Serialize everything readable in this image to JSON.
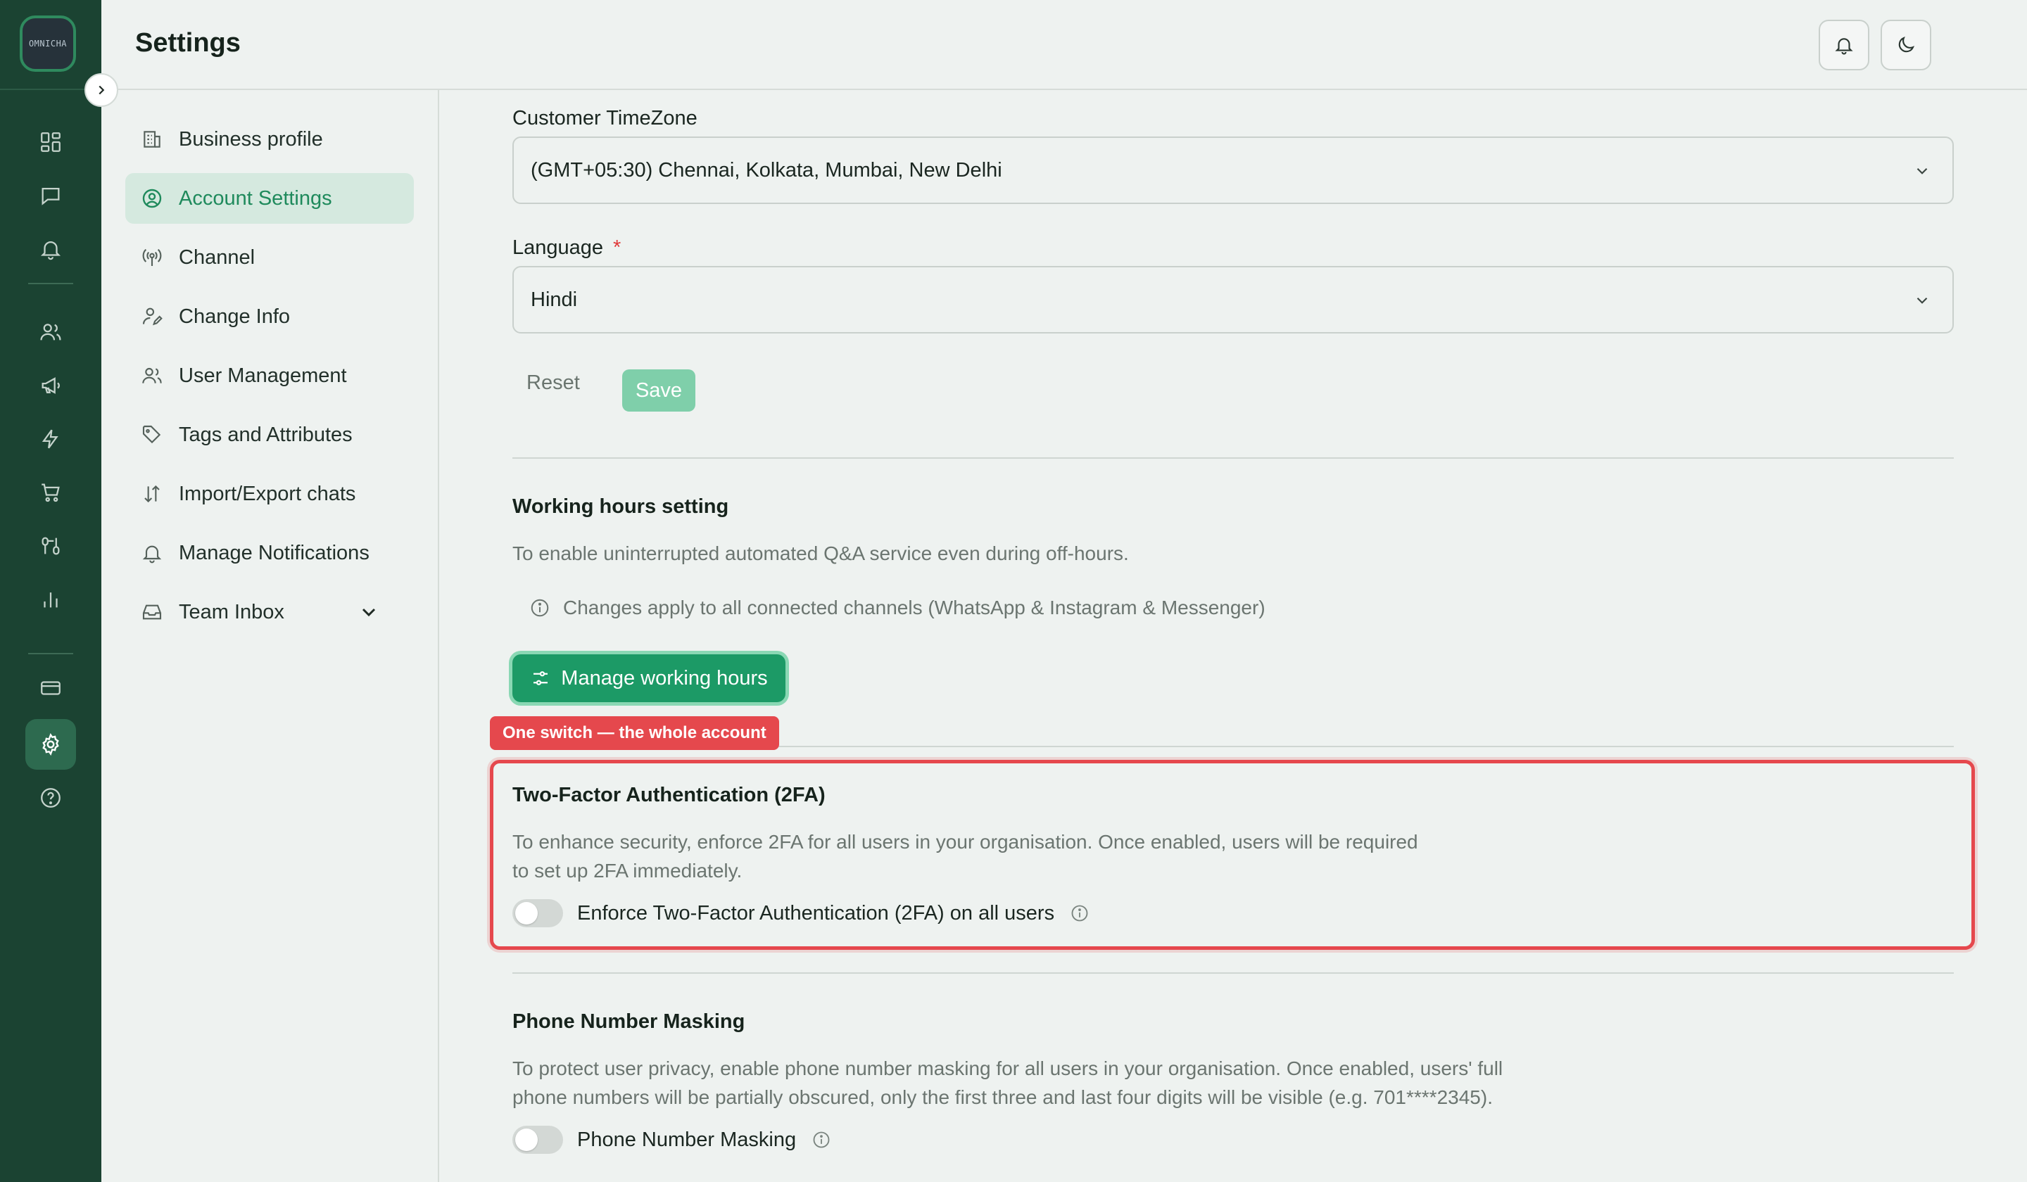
{
  "rail": {
    "logo_text": "OMNICHA",
    "items": [
      "dashboard-icon",
      "chat-icon",
      "bell-icon",
      "users-icon",
      "megaphone-icon",
      "flash-icon",
      "cart-icon",
      "flow-icon",
      "analytics-icon",
      "card-icon",
      "gear-icon",
      "help-icon"
    ],
    "active": "gear-icon"
  },
  "header": {
    "title": "Settings"
  },
  "nav": {
    "items": [
      {
        "label": "Business profile",
        "icon": "building-icon"
      },
      {
        "label": "Account Settings",
        "icon": "user-circle-icon"
      },
      {
        "label": "Channel",
        "icon": "broadcast-icon"
      },
      {
        "label": "Change Info",
        "icon": "user-edit-icon"
      },
      {
        "label": "User Management",
        "icon": "users-icon"
      },
      {
        "label": "Tags and Attributes",
        "icon": "tag-icon"
      },
      {
        "label": "Import/Export chats",
        "icon": "arrows-updown-icon"
      },
      {
        "label": "Manage Notifications",
        "icon": "bell-icon"
      },
      {
        "label": "Team Inbox",
        "icon": "inbox-icon"
      }
    ],
    "active": "Account Settings"
  },
  "timezone": {
    "label": "Customer TimeZone",
    "value": "(GMT+05:30) Chennai, Kolkata, Mumbai, New Delhi"
  },
  "language": {
    "label": "Language",
    "required_mark": "*",
    "value": "Hindi"
  },
  "form_actions": {
    "reset_label": "Reset",
    "save_label": "Save"
  },
  "working_hours": {
    "title": "Working hours setting",
    "description": "To enable uninterrupted automated Q&A service even during off-hours.",
    "note": "Changes apply to all connected channels (WhatsApp & Instagram & Messenger)",
    "button_label": "Manage working hours"
  },
  "callout": {
    "text": "One switch — the whole account"
  },
  "two_fa": {
    "title": "Two-Factor Authentication (2FA)",
    "description_line1": "To enhance security, enforce 2FA for all users in your organisation. Once enabled, users will be required",
    "description_line2": "to set up 2FA immediately.",
    "toggle_label": "Enforce Two-Factor Authentication (2FA) on all users",
    "enabled": false
  },
  "masking": {
    "title": "Phone Number Masking",
    "description_line1": "To protect user privacy, enable phone number masking for all users in your organisation. Once enabled, users' full",
    "description_line2": "phone numbers will be partially obscured, only the first three and last four digits will be visible (e.g. 701****2345).",
    "toggle_label": "Phone Number Masking",
    "enabled": false
  },
  "colors": {
    "brand_dark": "#1b4332",
    "accent": "#1c9a66",
    "highlight": "#e5484d"
  }
}
